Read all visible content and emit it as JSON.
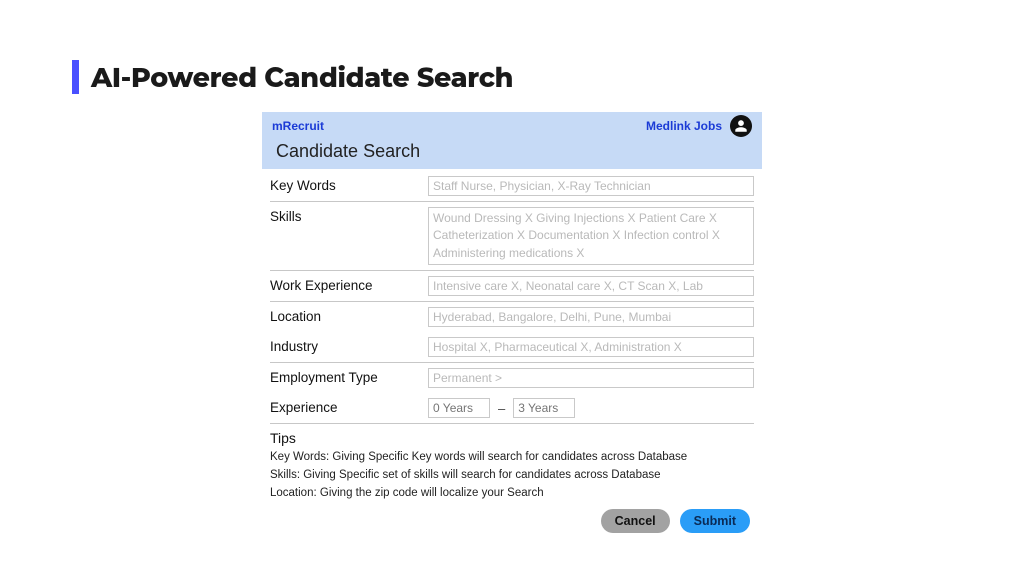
{
  "page": {
    "title": "AI-Powered Candidate Search"
  },
  "header": {
    "brand_left": "mRecruit",
    "brand_right": "Medlink Jobs"
  },
  "section": {
    "title": "Candidate Search"
  },
  "form": {
    "key_words": {
      "label": "Key Words",
      "placeholder": "Staff Nurse, Physician, X-Ray Technician"
    },
    "skills": {
      "label": "Skills",
      "placeholder": "Wound Dressing X  Giving Injections X  Patient Care X  Catheterization X  Documentation X  Infection control X  Administering medications X"
    },
    "work_experience": {
      "label": "Work Experience",
      "placeholder": "Intensive care X, Neonatal care X, CT Scan X, Lab"
    },
    "location": {
      "label": "Location",
      "placeholder": "Hyderabad, Bangalore, Delhi, Pune, Mumbai"
    },
    "industry": {
      "label": "Industry",
      "placeholder": "Hospital X, Pharmaceutical X, Administration X"
    },
    "employment_type": {
      "label": "Employment Type",
      "placeholder": "Permanent >"
    },
    "experience": {
      "label": "Experience",
      "from_placeholder": "0 Years",
      "to_placeholder": "3 Years",
      "dash": "–"
    }
  },
  "tips": {
    "title": "Tips",
    "line1": "Key Words: Giving Specific Key words will search for candidates across Database",
    "line2": "Skills: Giving Specific set of skills will search for candidates across Database",
    "line3": "Location: Giving the zip code will localize your Search"
  },
  "actions": {
    "cancel": "Cancel",
    "submit": "Submit"
  }
}
